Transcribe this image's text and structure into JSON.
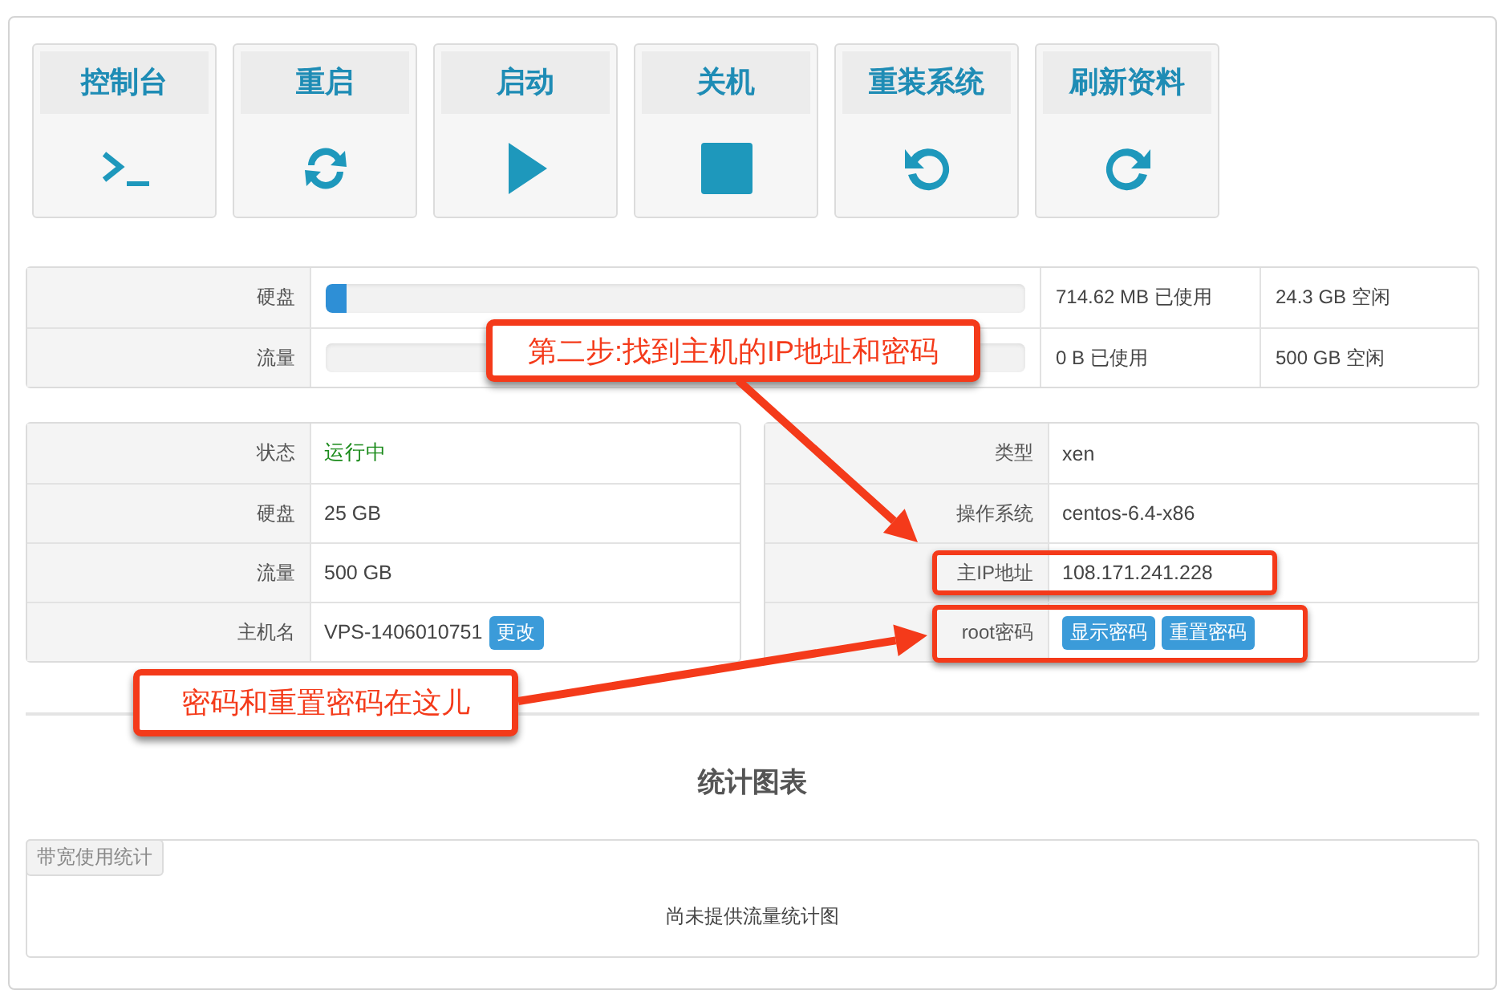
{
  "actions": [
    {
      "label": "控制台",
      "kind": "terminal"
    },
    {
      "label": "重启",
      "kind": "sync"
    },
    {
      "label": "启动",
      "kind": "play"
    },
    {
      "label": "关机",
      "kind": "stop"
    },
    {
      "label": "重装系统",
      "kind": "undo"
    },
    {
      "label": "刷新资料",
      "kind": "redo"
    }
  ],
  "usage": [
    {
      "label": "硬盘",
      "level": 0.03,
      "used": "714.62 MB 已使用",
      "free": "24.3 GB 空闲"
    },
    {
      "label": "流量",
      "level": 0,
      "used": "0 B 已使用",
      "free": "500 GB 空闲"
    }
  ],
  "info_left": [
    {
      "label": "状态",
      "value": "运行中",
      "kind": "status"
    },
    {
      "label": "硬盘",
      "value": "25 GB",
      "kind": "text"
    },
    {
      "label": "流量",
      "value": "500 GB",
      "kind": "text"
    },
    {
      "label": "主机名",
      "value": "VPS-1406010751",
      "kind": "text",
      "buttons": [
        "更改"
      ]
    }
  ],
  "info_right": [
    {
      "label": "类型",
      "value": "xen",
      "kind": "text"
    },
    {
      "label": "操作系统",
      "value": "centos-6.4-x86",
      "kind": "text"
    },
    {
      "label": "主IP地址",
      "value": "108.171.241.228",
      "kind": "text",
      "highlight": true
    },
    {
      "label": "root密码",
      "kind": "buttons",
      "buttons": [
        "显示密码",
        "重置密码"
      ],
      "highlight": true
    }
  ],
  "stats": {
    "title": "统计图表",
    "tab": "带宽使用统计",
    "message": "尚未提供流量统计图"
  },
  "annotations": [
    {
      "text": "第二步:找到主机的IP地址和密码",
      "kind": "step2"
    },
    {
      "text": "密码和重置密码在这儿",
      "kind": "password"
    }
  ]
}
